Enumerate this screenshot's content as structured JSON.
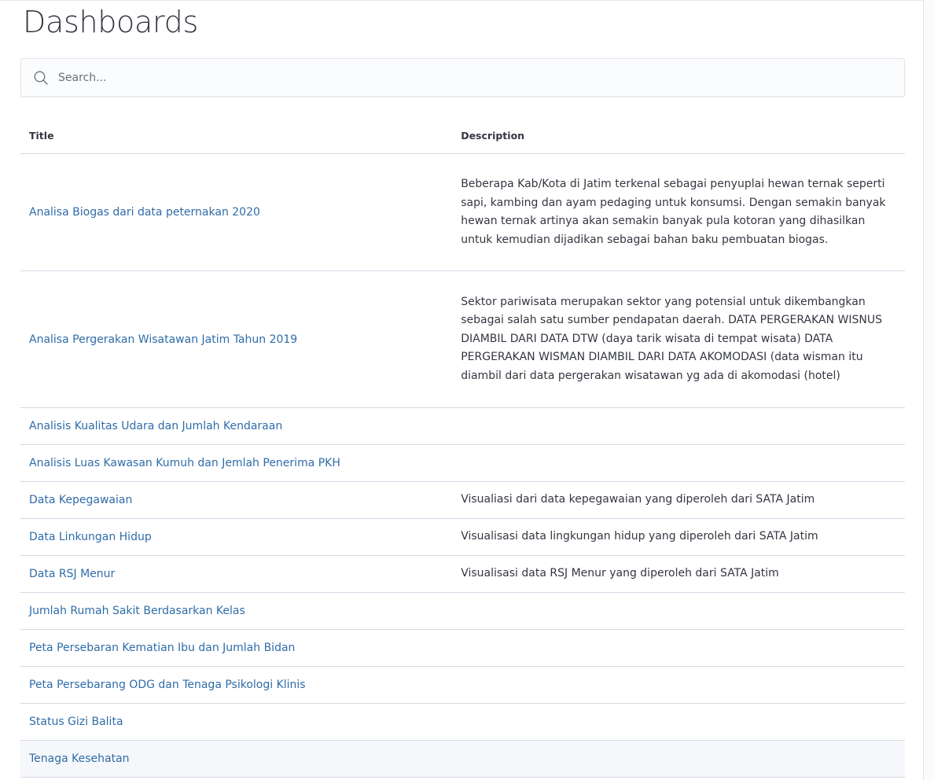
{
  "page": {
    "title": "Dashboards"
  },
  "search": {
    "placeholder": "Search..."
  },
  "table": {
    "headers": {
      "title": "Title",
      "description": "Description"
    },
    "rows": [
      {
        "title": "Analisa Biogas dari data peternakan 2020",
        "description": "Beberapa Kab/Kota di Jatim terkenal sebagai penyuplai hewan ternak seperti sapi, kambing dan ayam pedaging untuk konsumsi. Dengan semakin banyak hewan ternak artinya akan semakin banyak pula kotoran yang dihasilkan untuk kemudian dijadikan sebagai bahan baku pembuatan biogas."
      },
      {
        "title": "Analisa Pergerakan Wisatawan Jatim Tahun 2019",
        "description": "Sektor pariwisata merupakan sektor yang potensial untuk dikembangkan sebagai salah satu sumber pendapatan daerah. DATA PERGERAKAN WISNUS DIAMBIL DARI DATA DTW (daya tarik wisata di tempat wisata) DATA PERGERAKAN WISMAN DIAMBIL DARI DATA AKOMODASI (data wisman itu diambil dari data pergerakan wisatawan yg ada di akomodasi (hotel)"
      },
      {
        "title": "Analisis Kualitas Udara dan Jumlah Kendaraan",
        "description": ""
      },
      {
        "title": "Analisis Luas Kawasan Kumuh dan Jemlah Penerima PKH",
        "description": ""
      },
      {
        "title": "Data Kepegawaian",
        "description": "Visualiasi dari data kepegawaian yang diperoleh dari SATA Jatim"
      },
      {
        "title": "Data Linkungan Hidup",
        "description": "Visualisasi data lingkungan hidup yang diperoleh dari SATA Jatim"
      },
      {
        "title": "Data RSJ Menur",
        "description": "Visualisasi data RSJ Menur yang diperoleh dari SATA Jatim"
      },
      {
        "title": "Jumlah Rumah Sakit Berdasarkan Kelas",
        "description": ""
      },
      {
        "title": "Peta Persebaran Kematian Ibu dan Jumlah Bidan",
        "description": ""
      },
      {
        "title": "Peta Persebarang ODG dan Tenaga Psikologi Klinis",
        "description": ""
      },
      {
        "title": "Status Gizi Balita",
        "description": ""
      },
      {
        "title": "Tenaga Kesehatan",
        "description": ""
      }
    ]
  },
  "colors": {
    "link": "#2f6ca8",
    "text": "#343741",
    "border": "#d3dae6"
  },
  "icons": {
    "search": "search-icon"
  }
}
